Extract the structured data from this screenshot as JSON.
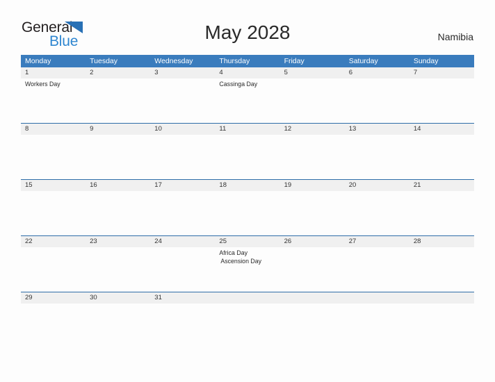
{
  "brand": {
    "name_part1": "General",
    "name_part2": "Blue",
    "accent_color": "#2e86d0",
    "triangle_color": "#2870b5"
  },
  "header": {
    "title": "May 2028",
    "country": "Namibia"
  },
  "calendar": {
    "header_color": "#3a7cbd",
    "date_band_color": "#f0f0f0",
    "rule_color": "#2d6ca8",
    "weekday_headers": [
      "Monday",
      "Tuesday",
      "Wednesday",
      "Thursday",
      "Friday",
      "Saturday",
      "Sunday"
    ],
    "weeks": [
      {
        "dates": [
          "1",
          "2",
          "3",
          "4",
          "5",
          "6",
          "7"
        ],
        "events": [
          [
            "Workers Day"
          ],
          [],
          [],
          [
            "Cassinga Day"
          ],
          [],
          [],
          []
        ]
      },
      {
        "dates": [
          "8",
          "9",
          "10",
          "11",
          "12",
          "13",
          "14"
        ],
        "events": [
          [],
          [],
          [],
          [],
          [],
          [],
          []
        ]
      },
      {
        "dates": [
          "15",
          "16",
          "17",
          "18",
          "19",
          "20",
          "21"
        ],
        "events": [
          [],
          [],
          [],
          [],
          [],
          [],
          []
        ]
      },
      {
        "dates": [
          "22",
          "23",
          "24",
          "25",
          "26",
          "27",
          "28"
        ],
        "events": [
          [],
          [],
          [],
          [
            "Africa Day",
            " Ascension Day"
          ],
          [],
          [],
          []
        ]
      },
      {
        "dates": [
          "29",
          "30",
          "31",
          "",
          "",
          "",
          ""
        ],
        "events": [
          [],
          [],
          [],
          [],
          [],
          [],
          []
        ]
      }
    ]
  }
}
